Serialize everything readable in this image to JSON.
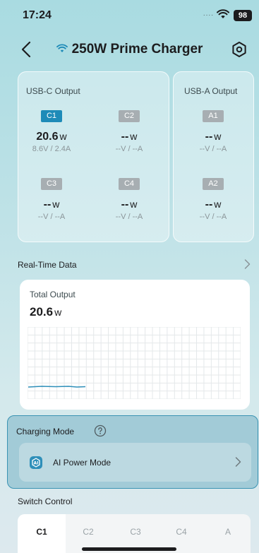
{
  "status_bar": {
    "time": "17:24",
    "dots": "....",
    "battery": "98"
  },
  "nav": {
    "title": "250W Prime Charger"
  },
  "usb_c": {
    "title": "USB-C Output",
    "ports": [
      {
        "id": "C1",
        "power": "20.6",
        "unit": "w",
        "va": "8.6V / 2.4A",
        "active": true
      },
      {
        "id": "C2",
        "power": "--",
        "unit": "w",
        "va": "--V / --A",
        "active": false
      },
      {
        "id": "C3",
        "power": "--",
        "unit": "w",
        "va": "--V / --A",
        "active": false
      },
      {
        "id": "C4",
        "power": "--",
        "unit": "w",
        "va": "--V / --A",
        "active": false
      }
    ]
  },
  "usb_a": {
    "title": "USB-A Output",
    "ports": [
      {
        "id": "A1",
        "power": "--",
        "unit": "w",
        "va": "--V / --A",
        "active": false
      },
      {
        "id": "A2",
        "power": "--",
        "unit": "w",
        "va": "--V / --A",
        "active": false
      }
    ]
  },
  "real_time": {
    "label": "Real-Time Data",
    "total_label": "Total Output",
    "total_value": "20.6",
    "total_unit": "w"
  },
  "charging_mode": {
    "label": "Charging Mode",
    "value": "AI Power Mode"
  },
  "switch_control": {
    "label": "Switch Control",
    "tabs": [
      "C1",
      "C2",
      "C3",
      "C4",
      "A"
    ],
    "selected": "C1"
  },
  "colors": {
    "accent": "#1e8bb8",
    "inactive_badge": "#a7aeb2"
  }
}
